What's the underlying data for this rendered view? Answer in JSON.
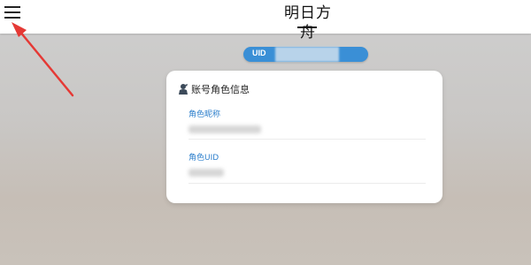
{
  "header": {
    "logo_text": "明日方舟",
    "menu_icon": "hamburger-menu-icon"
  },
  "uid_bar": {
    "label": "UID",
    "value": ""
  },
  "account_card": {
    "title": "账号角色信息",
    "icon": "account-role-icon",
    "fields": [
      {
        "label": "角色昵称",
        "value": ""
      },
      {
        "label": "角色UID",
        "value": ""
      }
    ]
  },
  "annotation": {
    "arrow_color": "#e53935"
  },
  "colors": {
    "accent_blue": "#3a8fd6",
    "label_blue": "#2d7fcc"
  }
}
